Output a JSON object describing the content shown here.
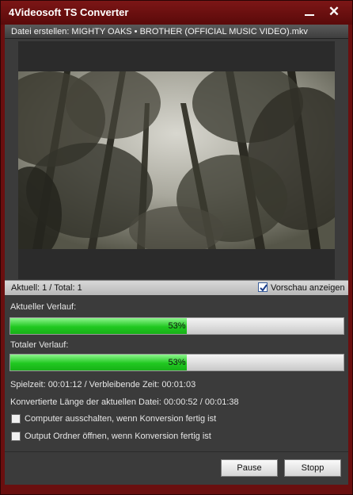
{
  "window": {
    "title": "4Videosoft TS Converter",
    "minimize_icon": "minimize-icon",
    "close_icon": "close-icon"
  },
  "file": {
    "label": "Datei erstellen: MIGHTY OAKS • BROTHER (OFFICIAL MUSIC VIDEO).mkv"
  },
  "status": {
    "count": "Aktuell: 1 / Total: 1",
    "preview_label": "Vorschau anzeigen",
    "preview_checked": true
  },
  "progress": {
    "current_label": "Aktueller Verlauf:",
    "current_percent": 53,
    "current_text": "53%",
    "total_label": "Totaler Verlauf:",
    "total_percent": 53,
    "total_text": "53%"
  },
  "info": {
    "time": "Spielzeit: 00:01:12 / Verbleibende Zeit: 00:01:03",
    "length": "Konvertierte Länge der aktuellen Datei: 00:00:52 / 00:01:38"
  },
  "options": {
    "shutdown_label": "Computer ausschalten, wenn Konversion fertig ist",
    "shutdown_checked": false,
    "open_folder_label": "Output Ordner öffnen, wenn Konversion fertig ist",
    "open_folder_checked": false
  },
  "buttons": {
    "pause": "Pause",
    "stop": "Stopp"
  },
  "colors": {
    "titlebar": "#6a0f0f",
    "progress_fill": "#20c820",
    "panel": "#3b3b3b"
  }
}
